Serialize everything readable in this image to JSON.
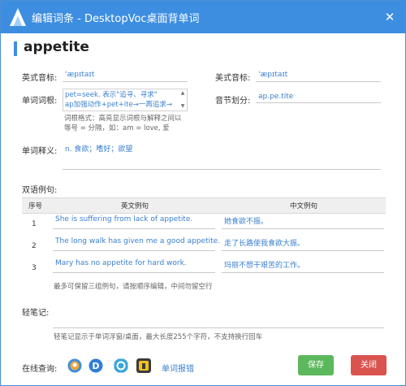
{
  "window": {
    "title": "编辑词条 - DesktopVoc桌面背单词"
  },
  "word": "appetite",
  "labels": {
    "uk_phonetic": "英式音标:",
    "us_phonetic": "美式音标:",
    "root": "单词词根:",
    "syllable": "音节划分:",
    "meaning": "单词释义:",
    "examples": "双语例句:",
    "notes": "轻笔记:",
    "online": "在线查询:"
  },
  "values": {
    "uk_phonetic": "'æpɪtaɪt",
    "us_phonetic": "'æpɪtaɪt",
    "root_line1": "pet=seek. 表示\"追寻、寻求\"",
    "root_line2": "ap加强动作+pet+ite→一再追求→",
    "syllable": "ap.pe.tite",
    "meaning": "n. 食欲；嗜好；欲望"
  },
  "hints": {
    "root_line1": "词根格式：高亮显示词根与解释之间以",
    "root_line2": "等号 = 分隔，如：am = love, 爱",
    "examples": "最多可保留三组例句，请按顺序编辑，中间勿留空行",
    "notes": "轻笔记显示于单词浮窗/桌面，最大长度255个字符，不支持换行回车"
  },
  "table": {
    "headers": [
      "序号",
      "英文例句",
      "中文例句"
    ],
    "rows": [
      {
        "num": "1",
        "en": "She is suffering from lack of appetite.",
        "zh": "她食欲不振。"
      },
      {
        "num": "2",
        "en": "The long walk has given me a good appetite.",
        "zh": "走了长路使我食欲大振。"
      },
      {
        "num": "3",
        "en": "Mary has no appetite for hard work.",
        "zh": "玛丽不想干艰苦的工作。"
      }
    ]
  },
  "footer": {
    "report_link": "单词报错",
    "save": "保存",
    "close": "关闭"
  },
  "online_icons": [
    "youdao-dict-icon",
    "dict-d-icon",
    "bing-dict-icon",
    "iciba-dict-icon"
  ],
  "colors": {
    "title_bar": "#3d8ee0",
    "save": "#5cb85c",
    "close": "#d9534f",
    "link": "#3a7fcf"
  }
}
